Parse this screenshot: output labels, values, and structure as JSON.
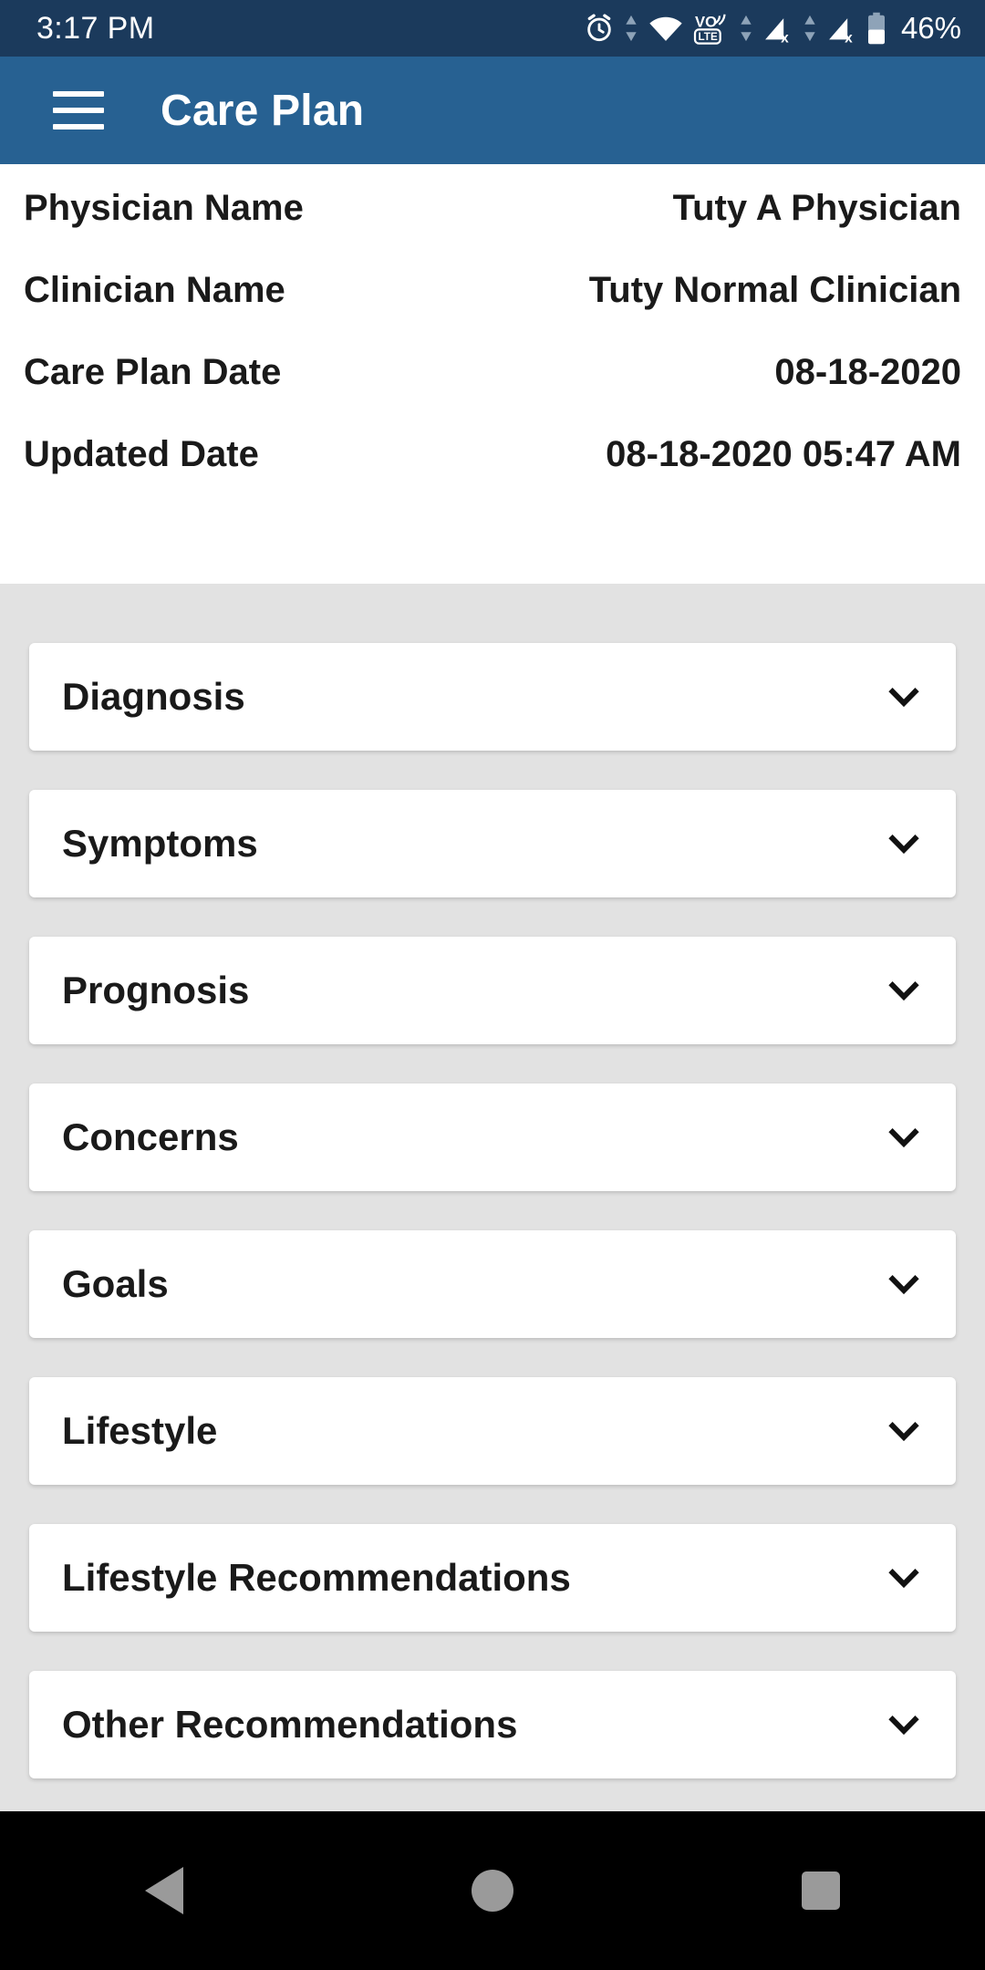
{
  "status_bar": {
    "time": "3:17 PM",
    "battery_percent": "46%",
    "icons": [
      "alarm-icon",
      "data-transfer-icon",
      "wifi-icon",
      "volte-icon",
      "data-transfer-icon",
      "signal-no-sim-icon",
      "data-transfer-icon",
      "signal-no-sim-icon",
      "battery-icon"
    ],
    "background_color": "#1b3a5c"
  },
  "app_bar": {
    "title": "Care Plan",
    "menu_icon": "hamburger-menu-icon",
    "background_color": "#276192"
  },
  "info": {
    "rows": [
      {
        "label": "Physician Name",
        "value": "Tuty A Physician"
      },
      {
        "label": "Clinician Name",
        "value": "Tuty Normal Clinician"
      },
      {
        "label": "Care Plan Date",
        "value": "08-18-2020"
      },
      {
        "label": "Updated Date",
        "value": "08-18-2020 05:47 AM"
      }
    ]
  },
  "accordion": {
    "expand_icon": "chevron-down-icon",
    "items": [
      {
        "label": "Diagnosis"
      },
      {
        "label": "Symptoms"
      },
      {
        "label": "Prognosis"
      },
      {
        "label": "Concerns"
      },
      {
        "label": "Goals"
      },
      {
        "label": "Lifestyle"
      },
      {
        "label": "Lifestyle Recommendations"
      },
      {
        "label": "Other Recommendations"
      },
      {
        "label": ""
      }
    ]
  },
  "nav_bar": {
    "back_label": "back-button",
    "home_label": "home-button",
    "recents_label": "recents-button"
  },
  "colors": {
    "status_bar": "#1b3a5c",
    "app_bar": "#276192",
    "page_background": "#e2e2e2",
    "card": "#ffffff",
    "text": "#1a1a1a"
  }
}
